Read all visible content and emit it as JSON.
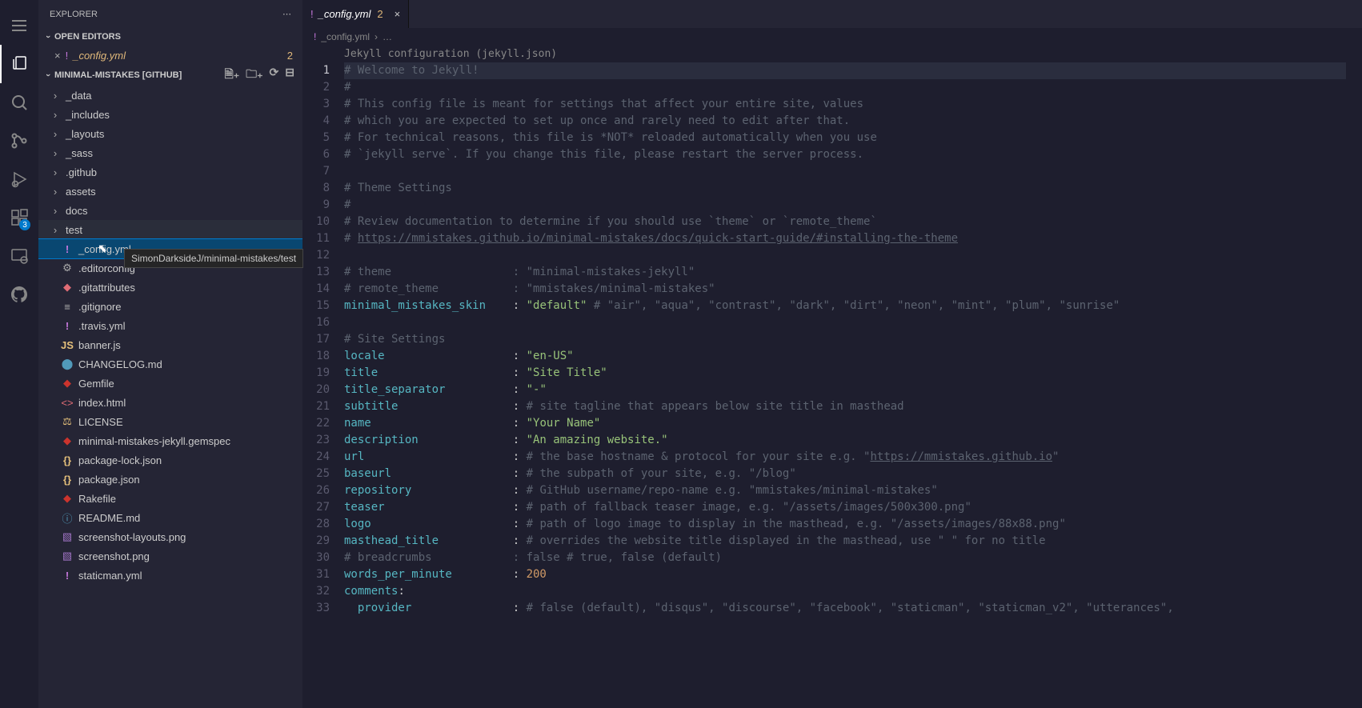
{
  "explorer_title": "EXPLORER",
  "open_editors_title": "OPEN EDITORS",
  "activity_badge_ext": "3",
  "open_editor": {
    "filename": "_config.yml",
    "count": "2"
  },
  "project": "MINIMAL-MISTAKES [GITHUB]",
  "folders": [
    "_data",
    "_includes",
    "_layouts",
    "_sass",
    ".github",
    "assets",
    "docs",
    "test"
  ],
  "files": [
    {
      "name": "_config.yml",
      "ic": "!",
      "cls": "ic-yml",
      "sel": true
    },
    {
      "name": ".editorconfig",
      "ic": "⚙",
      "cls": "ic-gear"
    },
    {
      "name": ".gitattributes",
      "ic": "◆",
      "cls": "ic-git"
    },
    {
      "name": ".gitignore",
      "ic": "≡",
      "cls": "ic-gear"
    },
    {
      "name": ".travis.yml",
      "ic": "!",
      "cls": "ic-yml"
    },
    {
      "name": "banner.js",
      "ic": "JS",
      "cls": "ic-js"
    },
    {
      "name": "CHANGELOG.md",
      "ic": "⬤",
      "cls": "ic-md"
    },
    {
      "name": "Gemfile",
      "ic": "◆",
      "cls": "ic-gem"
    },
    {
      "name": "index.html",
      "ic": "<>",
      "cls": "ic-html"
    },
    {
      "name": "LICENSE",
      "ic": "⚖",
      "cls": "ic-lic"
    },
    {
      "name": "minimal-mistakes-jekyll.gemspec",
      "ic": "◆",
      "cls": "ic-gem"
    },
    {
      "name": "package-lock.json",
      "ic": "{}",
      "cls": "ic-json"
    },
    {
      "name": "package.json",
      "ic": "{}",
      "cls": "ic-json"
    },
    {
      "name": "Rakefile",
      "ic": "◆",
      "cls": "ic-rake"
    },
    {
      "name": "README.md",
      "ic": "ⓘ",
      "cls": "ic-info"
    },
    {
      "name": "screenshot-layouts.png",
      "ic": "▧",
      "cls": "ic-img"
    },
    {
      "name": "screenshot.png",
      "ic": "▧",
      "cls": "ic-img"
    },
    {
      "name": "staticman.yml",
      "ic": "!",
      "cls": "ic-yml"
    }
  ],
  "tooltip": "SimonDarksideJ/minimal-mistakes/test",
  "tab": {
    "filename": "_config.yml",
    "mod": "2"
  },
  "breadcrumbs": {
    "file": "_config.yml",
    "rest": "…"
  },
  "hint": "Jekyll configuration (jekyll.json)",
  "code": {
    "l1": "# Welcome to Jekyll!",
    "l2": "#",
    "l3": "# This config file is meant for settings that affect your entire site, values",
    "l4": "# which you are expected to set up once and rarely need to edit after that.",
    "l5": "# For technical reasons, this file is *NOT* reloaded automatically when you use",
    "l6": "# `jekyll serve`. If you change this file, please restart the server process.",
    "l8": "# Theme Settings",
    "l9": "#",
    "l10": "# Review documentation to determine if you should use `theme` or `remote_theme`",
    "l11a": "# ",
    "l11b": "https://mmistakes.github.io/minimal-mistakes/docs/quick-start-guide/#installing-the-theme",
    "l13": "# theme                  : \"minimal-mistakes-jekyll\"",
    "l14": "# remote_theme           : \"mmistakes/minimal-mistakes\"",
    "k15": "minimal_mistakes_skin",
    "s15": "\"default\"",
    "c15": " # \"air\", \"aqua\", \"contrast\", \"dark\", \"dirt\", \"neon\", \"mint\", \"plum\", \"sunrise\"",
    "l17": "# Site Settings",
    "k18": "locale",
    "s18": "\"en-US\"",
    "k19": "title",
    "s19": "\"Site Title\"",
    "k20": "title_separator",
    "s20": "\"-\"",
    "k21": "subtitle",
    "c21": "# site tagline that appears below site title in masthead",
    "k22": "name",
    "s22": "\"Your Name\"",
    "k23": "description",
    "s23": "\"An amazing website.\"",
    "k24": "url",
    "c24a": "# the base hostname & protocol for your site e.g. \"",
    "c24b": "https://mmistakes.github.io",
    "c24c": "\"",
    "k25": "baseurl",
    "c25": "# the subpath of your site, e.g. \"/blog\"",
    "k26": "repository",
    "c26": "# GitHub username/repo-name e.g. \"mmistakes/minimal-mistakes\"",
    "k27": "teaser",
    "c27": "# path of fallback teaser image, e.g. \"/assets/images/500x300.png\"",
    "k28": "logo",
    "c28": "# path of logo image to display in the masthead, e.g. \"/assets/images/88x88.png\"",
    "k29": "masthead_title",
    "c29": "# overrides the website title displayed in the masthead, use \" \" for no title",
    "l30": "# breadcrumbs            : false # true, false (default)",
    "k31": "words_per_minute",
    "n31": "200",
    "k32": "comments",
    "k33": "provider",
    "c33": "# false (default), \"disqus\", \"discourse\", \"facebook\", \"staticman\", \"staticman_v2\", \"utterances\","
  }
}
